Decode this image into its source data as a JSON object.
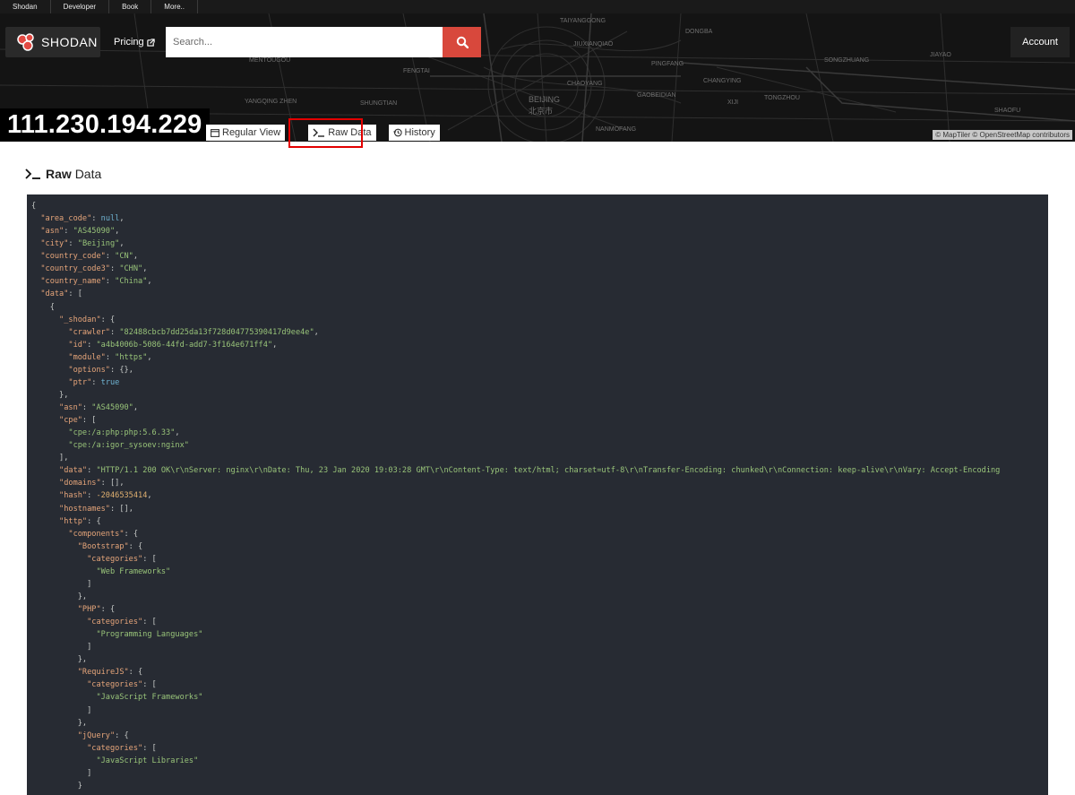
{
  "topnav": {
    "items": [
      "Shodan",
      "Developer",
      "Book",
      "More.."
    ]
  },
  "header": {
    "logo_text": "SHODAN",
    "pricing_label": "Pricing",
    "search_placeholder": "Search...",
    "account_label": "Account",
    "map_attribution": "© MapTiler © OpenStreetMap contributors",
    "map_labels": [
      "TAIYANGGONG",
      "DONGBA",
      "BEIJING",
      "北京市",
      "CHAOYANG",
      "PINGFANG",
      "SONGZHUANG",
      "TONGZHOU",
      "MENTOUGOU",
      "SHUNGTIAN",
      "FENGTAI",
      "YANGQING ZHEN",
      "JIUXIANQIAO",
      "CHANGYING",
      "GAOBEIDIAN",
      "NANMOFANG",
      "JIAYAO",
      "SHAOFU",
      "XIJI"
    ]
  },
  "ip_address": "111.230.194.229",
  "tabs": {
    "regular_view": "Regular View",
    "raw_data": "Raw Data",
    "history": "History"
  },
  "section": {
    "title_bold": "Raw",
    "title_rest": "Data"
  },
  "raw_json": {
    "area_code": "null",
    "asn": "\"AS45090\"",
    "city": "\"Beijing\"",
    "country_code": "\"CN\"",
    "country_code3": "\"CHN\"",
    "country_name": "\"China\"",
    "shodan_crawler": "\"82488cbcb7dd25da13f728d04775390417d9ee4e\"",
    "shodan_id": "\"a4b4006b-5086-44fd-add7-3f164e671ff4\"",
    "shodan_module": "\"https\"",
    "shodan_options": "{}",
    "shodan_ptr": "true",
    "data_asn": "\"AS45090\"",
    "cpe_0": "\"cpe:/a:php:php:5.6.33\"",
    "cpe_1": "\"cpe:/a:igor_sysoev:nginx\"",
    "data_data": "\"HTTP/1.1 200 OK\\r\\nServer: nginx\\r\\nDate: Thu, 23 Jan 2020 19:03:28 GMT\\r\\nContent-Type: text/html; charset=utf-8\\r\\nTransfer-Encoding: chunked\\r\\nConnection: keep-alive\\r\\nVary: Accept-Encoding",
    "domains": "[]",
    "hash": "-2046535414",
    "hostnames": "[]",
    "bootstrap_cat": "\"Web Frameworks\"",
    "php_cat": "\"Programming Languages\"",
    "requirejs_cat": "\"JavaScript Frameworks\"",
    "jquery_cat": "\"JavaScript Libraries\""
  },
  "colors": {
    "search_button": "#d8483c",
    "code_bg": "#272b33",
    "highlight": "#e30000"
  }
}
